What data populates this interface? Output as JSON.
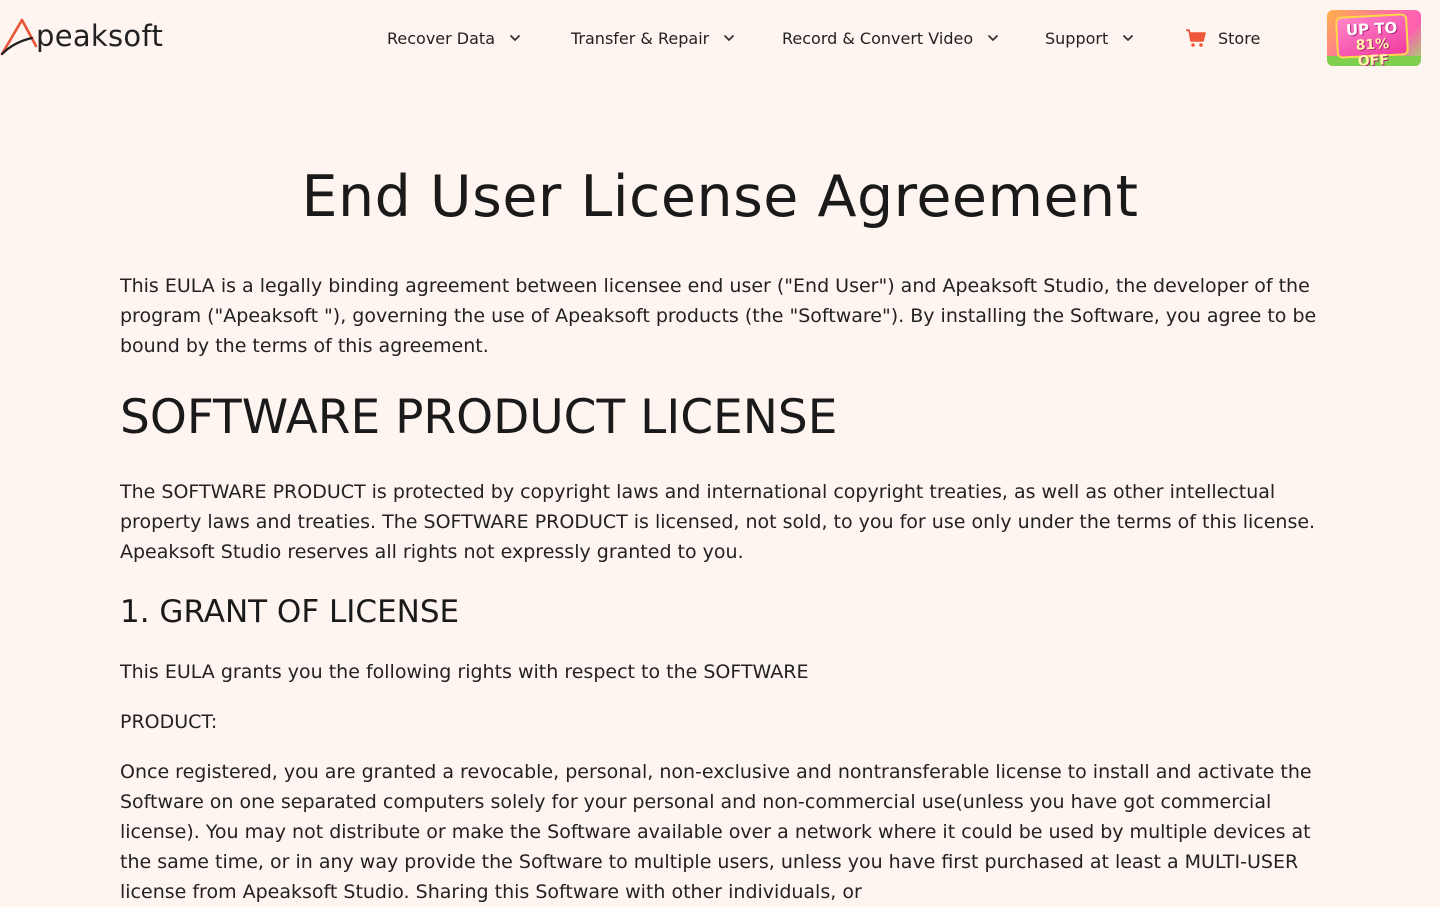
{
  "header": {
    "logo_text": "peaksoft",
    "nav": [
      {
        "label": "Recover Data"
      },
      {
        "label": "Transfer & Repair"
      },
      {
        "label": "Record & Convert Video"
      },
      {
        "label": "Support"
      }
    ],
    "store_label": "Store",
    "promo": {
      "line1": "UP TO",
      "line2": "81% OFF"
    }
  },
  "colors": {
    "background": "#fef4f0",
    "brand_accent": "#e8563a",
    "cart": "#f0563a"
  },
  "content": {
    "title": "End User License Agreement",
    "intro": "This EULA is a legally binding agreement between licensee end user (\"End User\") and Apeaksoft Studio, the developer of the program (\"Apeaksoft \"), governing the use of Apeaksoft products (the \"Software\"). By installing the Software, you agree to be bound by the terms of this agreement.",
    "section_heading": "SOFTWARE PRODUCT LICENSE",
    "section_paragraph": "The SOFTWARE PRODUCT is protected by copyright laws and international copyright treaties, as well as other intellectual property laws and treaties. The SOFTWARE PRODUCT is licensed, not sold, to you for use only under the terms of this license. Apeaksoft Studio reserves all rights not expressly granted to you.",
    "grant_heading": "1. GRANT OF LICENSE",
    "grant_line1": "This EULA grants you the following rights with respect to the SOFTWARE",
    "grant_line2": "PRODUCT:",
    "grant_paragraph": "Once registered, you are granted a revocable, personal, non-exclusive and nontransferable license to install and activate the Software on one separated computers solely for your personal and non-commercial use(unless you have got commercial license). You may not distribute or make the Software available over a network where it could be used by multiple devices at the same time, or in any way provide the Software to multiple users, unless you have first purchased at least a MULTI-USER license from Apeaksoft Studio. Sharing this Software with other individuals, or"
  }
}
